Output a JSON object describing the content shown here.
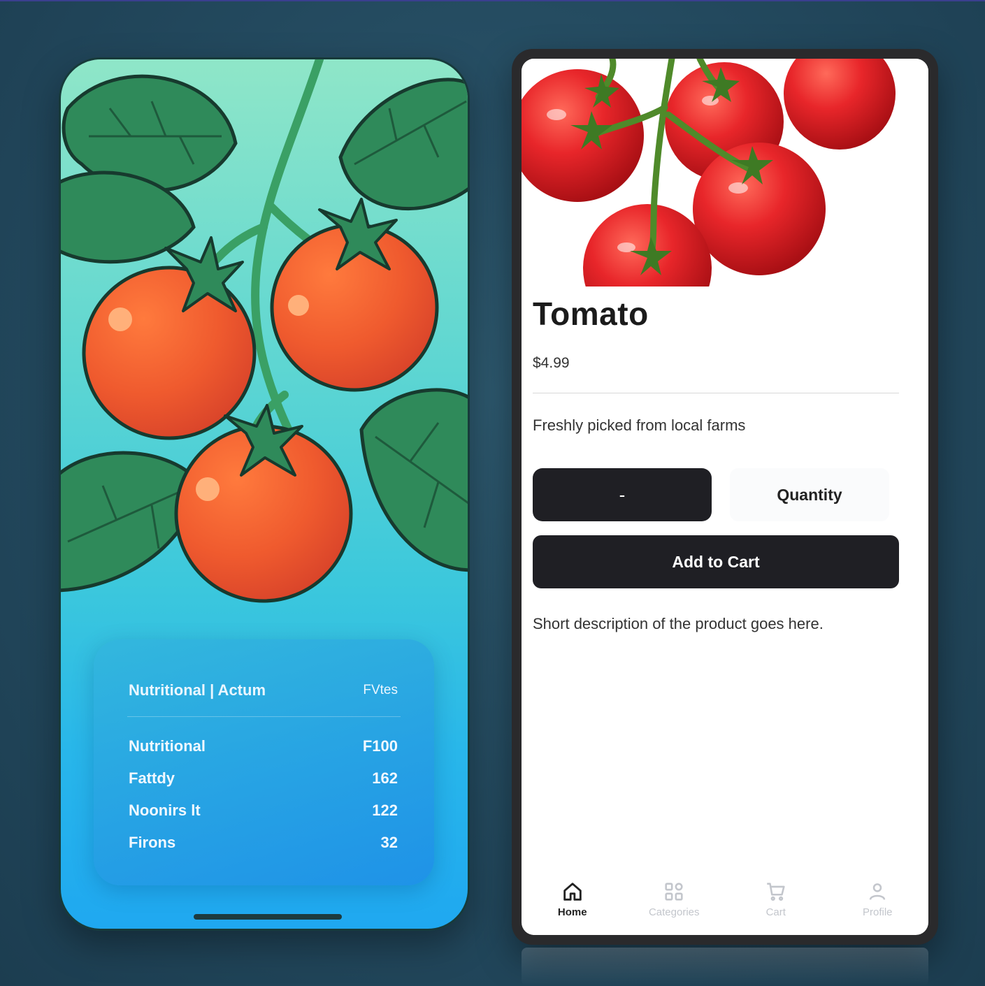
{
  "nutrition_card": {
    "header_left": "Nutritional | Actum",
    "header_right": "FVtes",
    "rows": [
      {
        "label": "Nutritional",
        "value": "F100"
      },
      {
        "label": "Fattdy",
        "value": "162"
      },
      {
        "label": "Noonirs lt",
        "value": "122"
      },
      {
        "label": "Firons",
        "value": "32"
      }
    ]
  },
  "product": {
    "title": "Tomato",
    "price": "$4.99",
    "tagline": "Freshly picked from local farms",
    "decrement_label": "-",
    "quantity_placeholder": "Quantity",
    "add_to_cart_label": "Add to Cart",
    "short_description": "Short description of the product goes here."
  },
  "tabbar": {
    "items": [
      {
        "label": "Home",
        "icon": "home-icon",
        "active": true
      },
      {
        "label": "Categories",
        "icon": "grid-icon",
        "active": false
      },
      {
        "label": "Cart",
        "icon": "cart-icon",
        "active": false
      },
      {
        "label": "Profile",
        "icon": "user-icon",
        "active": false
      }
    ]
  },
  "colors": {
    "button_dark": "#1f1f24",
    "tomato_red": "#e8352a",
    "leaf_green": "#2f8a5a"
  }
}
